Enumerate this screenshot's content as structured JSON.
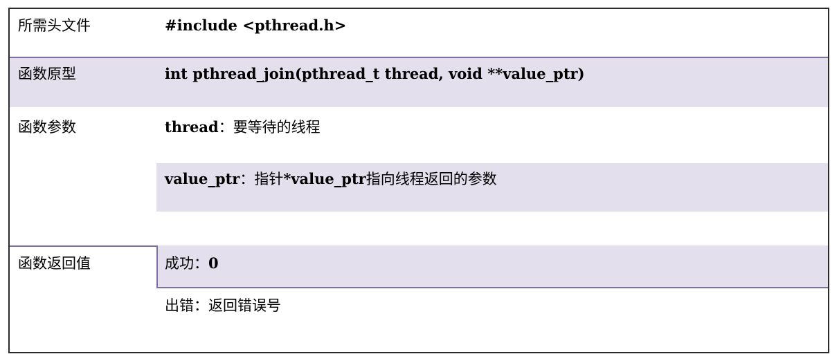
{
  "rows": {
    "header_file": {
      "label": "所需头文件",
      "value": "#include <pthread.h>"
    },
    "prototype": {
      "label": "函数原型",
      "value": "int  pthread_join(pthread_t thread,  void **value_ptr)"
    },
    "params": {
      "label": "函数参数",
      "items": [
        {
          "name": "thread",
          "sep": "：",
          "desc": "要等待的线程"
        },
        {
          "name": "value_ptr",
          "sep": "：",
          "desc_pre": "指针",
          "desc_bold": "*value_ptr",
          "desc_post": "指向线程返回的参数"
        }
      ]
    },
    "return_value": {
      "label": "函数返回值",
      "items": [
        {
          "name": "成功",
          "sep": "：",
          "desc": "0"
        },
        {
          "name": "出错",
          "sep": "：",
          "desc": "返回错误号"
        }
      ]
    }
  },
  "colors": {
    "band": "#e4dfec",
    "rule": "#7f6fa0",
    "border": "#2b2b2b"
  }
}
